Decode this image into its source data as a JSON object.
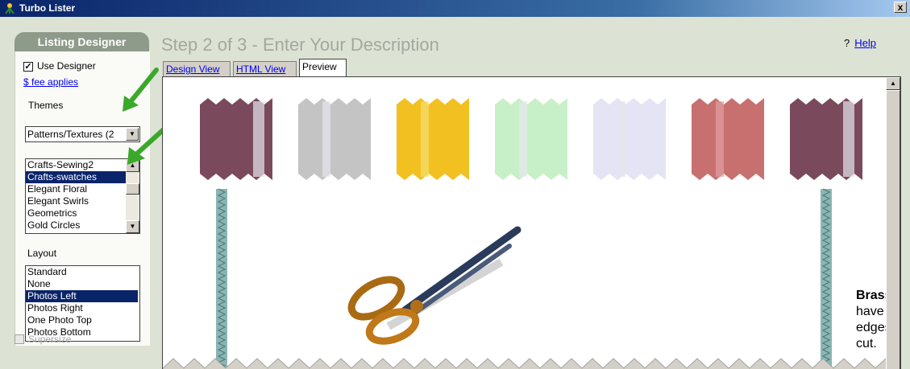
{
  "window": {
    "title": "Turbo Lister",
    "close_label": "x"
  },
  "panel": {
    "header": "Listing Designer",
    "use_designer_label": "Use Designer",
    "use_designer_checked": true,
    "fee_link": "$ fee applies",
    "themes_label": "Themes",
    "theme_combo_value": "Patterns/Textures (2",
    "theme_list": [
      "Crafts-Sewing2",
      "Crafts-swatches",
      "Elegant Floral",
      "Elegant Swirls",
      "Geometrics",
      "Gold Circles"
    ],
    "theme_selected_index": 1,
    "layout_label": "Layout",
    "layout_list": [
      "Standard",
      "None",
      "Photos Left",
      "Photos Right",
      "One Photo Top",
      "Photos Bottom"
    ],
    "layout_selected_index": 2,
    "supersize_label": "Supersize",
    "supersize_checked": false
  },
  "main": {
    "step_title": "Step 2 of 3 - Enter Your Description",
    "help_icon": "?",
    "help_link": "Help",
    "tabs": [
      {
        "label": "Design View",
        "active": false
      },
      {
        "label": "HTML View",
        "active": false
      },
      {
        "label": "Preview",
        "active": true
      }
    ]
  },
  "preview": {
    "product_name": "Brass Scissors",
    "product_desc": "have steel blade edges for a precision cut.",
    "swatches": [
      {
        "name": "plum",
        "color": "#7a4a5c"
      },
      {
        "name": "grey-stripe",
        "color": "#c4c4c4"
      },
      {
        "name": "yellow-leaf",
        "color": "#f2c020"
      },
      {
        "name": "green-grid",
        "color": "#c8f0c8"
      },
      {
        "name": "lavender-stripe",
        "color": "#e4e4f4"
      },
      {
        "name": "red-stripe",
        "color": "#c87070"
      },
      {
        "name": "plum-2",
        "color": "#7a4a5c"
      }
    ]
  },
  "colors": {
    "accent_arrow": "#3aa82a",
    "selection": "#0a246a",
    "panel_header": "#8e9a8a"
  }
}
